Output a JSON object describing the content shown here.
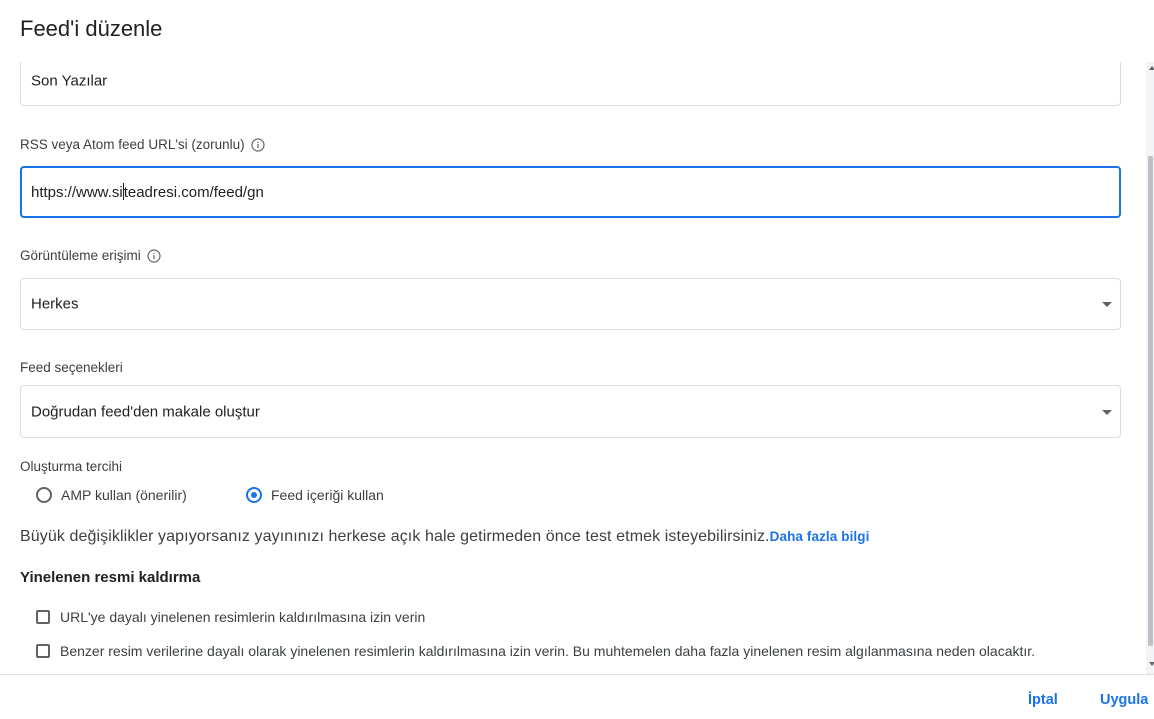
{
  "dialog": {
    "title": "Feed'i düzenle"
  },
  "fields": {
    "name_value": "Son Yazılar",
    "url_label": "RSS veya Atom feed URL'si (zorunlu)",
    "url_value_before_cursor": "https://www.si",
    "url_value_after_cursor": "teadresi.com/feed/gn",
    "access_label": "Görüntüleme erişimi",
    "access_value": "Herkes",
    "options_label": "Feed seçenekleri",
    "options_value": "Doğrudan feed'den makale oluştur"
  },
  "creation": {
    "label": "Oluşturma tercihi",
    "options": [
      {
        "label": "AMP kullan (önerilir)",
        "checked": false
      },
      {
        "label": "Feed içeriği kullan",
        "checked": true
      }
    ]
  },
  "notice": {
    "text": "Büyük değişiklikler yapıyorsanız yayınınızı herkese açık hale getirmeden önce test etmek isteyebilirsiniz.",
    "link": "Daha fazla bilgi"
  },
  "dedupe": {
    "title": "Yinelenen resmi kaldırma",
    "options": [
      {
        "label": "URL'ye dayalı yinelenen resimlerin kaldırılmasına izin verin",
        "checked": false
      },
      {
        "label": "Benzer resim verilerine dayalı olarak yinelenen resimlerin kaldırılmasına izin verin. Bu muhtemelen daha fazla yinelenen resim algılanmasına neden olacaktır.",
        "checked": false
      }
    ]
  },
  "footer": {
    "cancel": "İptal",
    "apply": "Uygula"
  },
  "colors": {
    "accent": "#1a73e8",
    "border": "#dadce0",
    "text": "#202124"
  },
  "icons": {
    "info": "info-icon",
    "dropdown": "chevron-down-icon"
  }
}
